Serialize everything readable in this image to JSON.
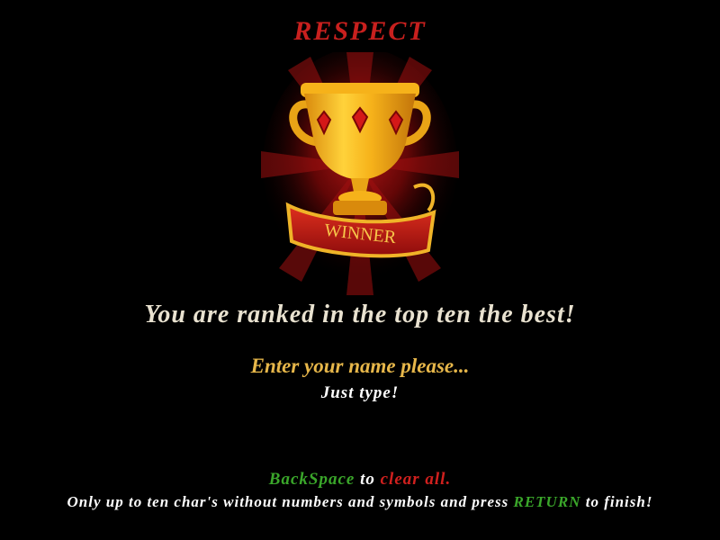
{
  "title": "RESPECT",
  "trophy": {
    "icon": "trophy-icon",
    "ribbon_text": "WINNER"
  },
  "message": {
    "ranked": "You are ranked in the top ten the best!",
    "prompt": "Enter your name please...",
    "hint": "Just type!"
  },
  "instructions": {
    "backspace_key": "BackSpace",
    "to_1": " to ",
    "clear_all": "clear all.",
    "line2_prefix": "Only up to ten char's without numbers and symbols and press ",
    "return_key": "RETURN",
    "line2_suffix": " to finish!"
  },
  "colors": {
    "background": "#000000",
    "title": "#c8201e",
    "ranked": "#e9e2d0",
    "prompt": "#e7b74a",
    "key_green": "#3aa62a",
    "key_red": "#d0201e"
  }
}
